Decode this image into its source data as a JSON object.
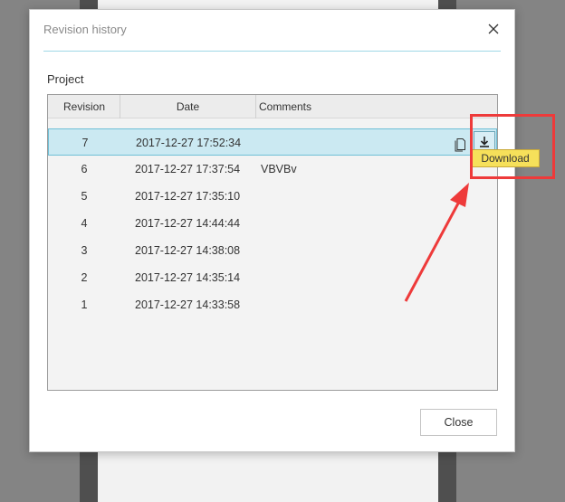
{
  "dialog": {
    "title": "Revision history",
    "section_label": "Project",
    "close_button_label": "Close"
  },
  "grid": {
    "columns": [
      "Revision",
      "Date",
      "Comments"
    ],
    "rows": [
      {
        "revision": "7",
        "date": "2017-12-27 17:52:34",
        "comment": ""
      },
      {
        "revision": "6",
        "date": "2017-12-27 17:37:54",
        "comment": "VBVBv"
      },
      {
        "revision": "5",
        "date": "2017-12-27 17:35:10",
        "comment": ""
      },
      {
        "revision": "4",
        "date": "2017-12-27 14:44:44",
        "comment": ""
      },
      {
        "revision": "3",
        "date": "2017-12-27 14:38:08",
        "comment": ""
      },
      {
        "revision": "2",
        "date": "2017-12-27 14:35:14",
        "comment": ""
      },
      {
        "revision": "1",
        "date": "2017-12-27 14:33:58",
        "comment": ""
      }
    ],
    "selected_index": 0
  },
  "tooltip": {
    "text": "Download"
  },
  "icons": {
    "close": "close-icon",
    "copy": "copy-icon",
    "download": "download-icon"
  },
  "colors": {
    "selection": "#cbe9f2",
    "tooltip": "#f6e05a",
    "annotation": "#ee3a3a"
  }
}
